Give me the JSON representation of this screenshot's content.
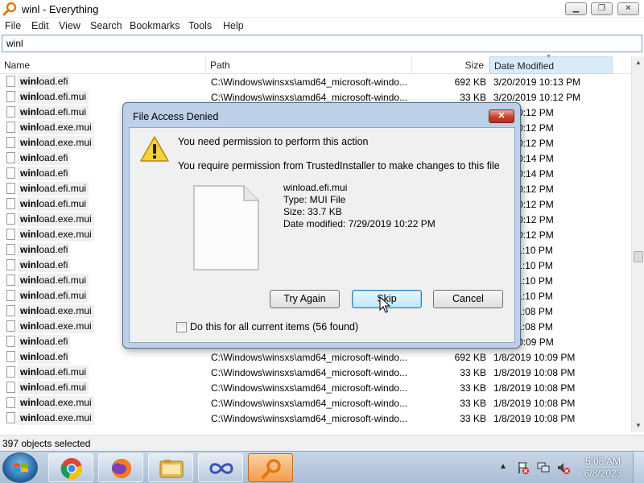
{
  "window": {
    "title": "winl - Everything",
    "min_glyph": "▁",
    "max_glyph": "❐",
    "close_glyph": "✕"
  },
  "menu": [
    "File",
    "Edit",
    "View",
    "Search",
    "Bookmarks",
    "Tools",
    "Help"
  ],
  "search": {
    "value": "winl"
  },
  "columns": {
    "name": "Name",
    "path": "Path",
    "size": "Size",
    "date": "Date Modified"
  },
  "rows": [
    {
      "pre": "winl",
      "post": "oad.efi",
      "path": "C:\\Windows\\winsxs\\amd64_microsoft-windo...",
      "size": "692 KB",
      "date": "3/20/2019 10:13 PM"
    },
    {
      "pre": "winl",
      "post": "oad.efi.mui",
      "path": "C:\\Windows\\winsxs\\amd64_microsoft-windo...",
      "size": "33 KB",
      "date": "3/20/2019 10:12 PM"
    },
    {
      "pre": "winl",
      "post": "oad.efi.mui",
      "path": "",
      "size": "",
      "date": "019 10:12 PM"
    },
    {
      "pre": "winl",
      "post": "oad.exe.mui",
      "path": "",
      "size": "",
      "date": "019 10:12 PM"
    },
    {
      "pre": "winl",
      "post": "oad.exe.mui",
      "path": "",
      "size": "",
      "date": "019 10:12 PM"
    },
    {
      "pre": "winl",
      "post": "oad.efi",
      "path": "",
      "size": "",
      "date": "019 10:14 PM"
    },
    {
      "pre": "winl",
      "post": "oad.efi",
      "path": "",
      "size": "",
      "date": "019 10:14 PM"
    },
    {
      "pre": "winl",
      "post": "oad.efi.mui",
      "path": "",
      "size": "",
      "date": "019 10:12 PM"
    },
    {
      "pre": "winl",
      "post": "oad.efi.mui",
      "path": "",
      "size": "",
      "date": "019 10:12 PM"
    },
    {
      "pre": "winl",
      "post": "oad.exe.mui",
      "path": "",
      "size": "",
      "date": "019 10:12 PM"
    },
    {
      "pre": "winl",
      "post": "oad.exe.mui",
      "path": "",
      "size": "",
      "date": "019 10:12 PM"
    },
    {
      "pre": "winl",
      "post": "oad.efi",
      "path": "",
      "size": "",
      "date": "019 11:10 PM"
    },
    {
      "pre": "winl",
      "post": "oad.efi",
      "path": "",
      "size": "",
      "date": "019 11:10 PM"
    },
    {
      "pre": "winl",
      "post": "oad.efi.mui",
      "path": "",
      "size": "",
      "date": "019 11:10 PM"
    },
    {
      "pre": "winl",
      "post": "oad.efi.mui",
      "path": "",
      "size": "",
      "date": "019 11:10 PM"
    },
    {
      "pre": "winl",
      "post": "oad.exe.mui",
      "path": "",
      "size": "",
      "date": "019 11:08 PM"
    },
    {
      "pre": "winl",
      "post": "oad.exe.mui",
      "path": "",
      "size": "",
      "date": "019 11:08 PM"
    },
    {
      "pre": "winl",
      "post": "oad.efi",
      "path": "",
      "size": "",
      "date": "019 10:09 PM"
    },
    {
      "pre": "winl",
      "post": "oad.efi",
      "path": "C:\\Windows\\winsxs\\amd64_microsoft-windo...",
      "size": "692 KB",
      "date": "1/8/2019 10:09 PM"
    },
    {
      "pre": "winl",
      "post": "oad.efi.mui",
      "path": "C:\\Windows\\winsxs\\amd64_microsoft-windo...",
      "size": "33 KB",
      "date": "1/8/2019 10:08 PM"
    },
    {
      "pre": "winl",
      "post": "oad.efi.mui",
      "path": "C:\\Windows\\winsxs\\amd64_microsoft-windo...",
      "size": "33 KB",
      "date": "1/8/2019 10:08 PM"
    },
    {
      "pre": "winl",
      "post": "oad.exe.mui",
      "path": "C:\\Windows\\winsxs\\amd64_microsoft-windo...",
      "size": "33 KB",
      "date": "1/8/2019 10:08 PM"
    },
    {
      "pre": "winl",
      "post": "oad.exe.mui",
      "path": "C:\\Windows\\winsxs\\amd64_microsoft-windo...",
      "size": "33 KB",
      "date": "1/8/2019 10:08 PM"
    }
  ],
  "status": {
    "text": "397 objects selected"
  },
  "dialog": {
    "title": "File Access Denied",
    "close_glyph": "✕",
    "message": "You need permission to perform this action",
    "detail": "You require permission from TrustedInstaller to make changes to this file",
    "file": {
      "name": "winload.efi.mui",
      "type": "Type: MUI File",
      "size": "Size: 33.7 KB",
      "modified": "Date modified: 7/29/2019 10:22 PM"
    },
    "buttons": {
      "try_again": "Try Again",
      "skip": "Skip",
      "cancel": "Cancel"
    },
    "checkbox": {
      "label": "Do this for all current items (56 found)",
      "checked": false
    }
  },
  "taskbar": {
    "apps": [
      "chrome-icon",
      "firefox-icon",
      "file-explorer-icon",
      "infinity-app-icon",
      "everything-search-icon"
    ],
    "active_app": "everything-search-icon",
    "clock": {
      "time": "5:08 AM",
      "date": "6/8/2023"
    }
  },
  "colors": {
    "dialog_frame": "#bcd0e8",
    "close_red": "#c8412e",
    "sort_header": "#d9ebf9",
    "taskbar": "#b5c8dc"
  }
}
